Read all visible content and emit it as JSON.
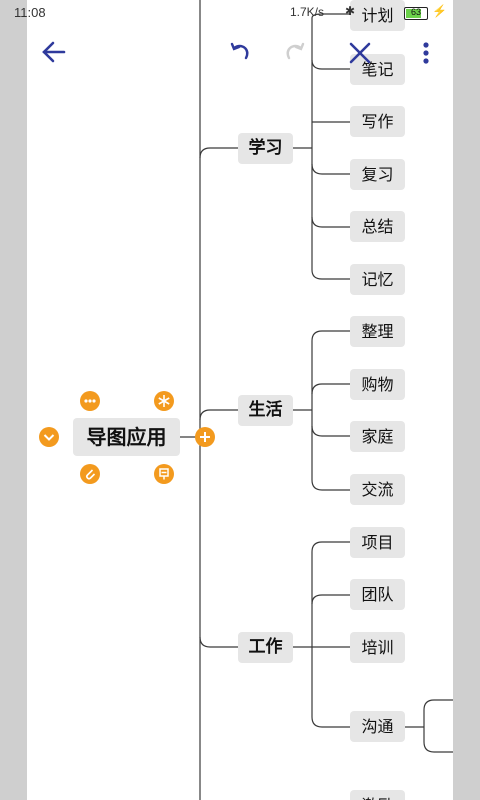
{
  "status_bar": {
    "time": "11:08",
    "network_speed": "1.7K/s",
    "battery": "63"
  },
  "toolbar": {
    "back_icon": "arrow-left-icon",
    "undo_icon": "undo-icon",
    "redo_icon": "redo-icon",
    "close_icon": "close-x-icon",
    "more_icon": "more-vertical-icon",
    "accent_color": "#2f3a9c"
  },
  "mindmap": {
    "root": "导图应用",
    "branches": [
      {
        "label": "学习",
        "children": [
          "计划",
          "笔记",
          "写作",
          "复习",
          "总结",
          "记忆"
        ]
      },
      {
        "label": "生活",
        "children": [
          "整理",
          "购物",
          "家庭",
          "交流"
        ]
      },
      {
        "label": "工作",
        "children": [
          "项目",
          "团队",
          "培训",
          "沟通",
          "激励"
        ]
      }
    ],
    "root_tools": {
      "more_icon": "more-horizontal-icon",
      "star_icon": "asterisk-icon",
      "collapse_icon": "chevron-down-icon",
      "add_icon": "plus-icon",
      "attach_icon": "paperclip-icon",
      "note_icon": "note-icon"
    },
    "accent_color": "#f39a1e"
  }
}
